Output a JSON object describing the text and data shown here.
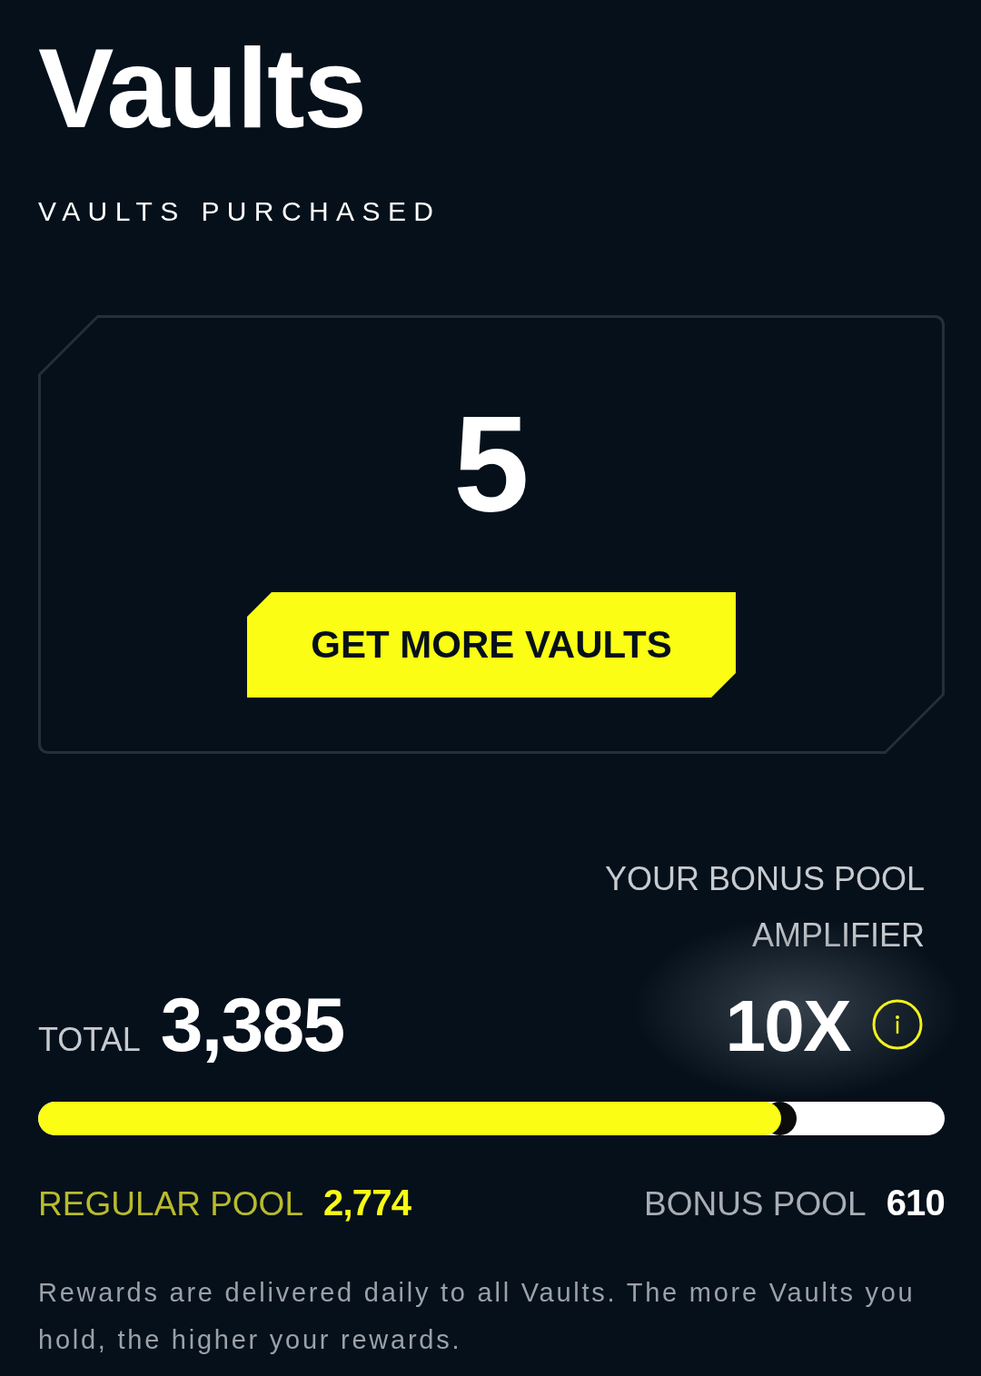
{
  "page": {
    "title": "Vaults",
    "subtitle": "VAULTS PURCHASED"
  },
  "vault_card": {
    "count": "5",
    "button": "GET MORE VAULTS"
  },
  "amplifier": {
    "label": "YOUR BONUS POOL AMPLIFIER",
    "value": "10X"
  },
  "total": {
    "label": "TOTAL",
    "value": "3,385"
  },
  "progress": {
    "level": 0.82
  },
  "pools": [
    {
      "kind": "regular",
      "label": "REGULAR POOL",
      "value": "2,774"
    },
    {
      "kind": "bonus",
      "label": "BONUS POOL",
      "value": "610"
    }
  ],
  "note": "Rewards are delivered daily to all Vaults. The more Vaults you hold, the higher your rewards."
}
